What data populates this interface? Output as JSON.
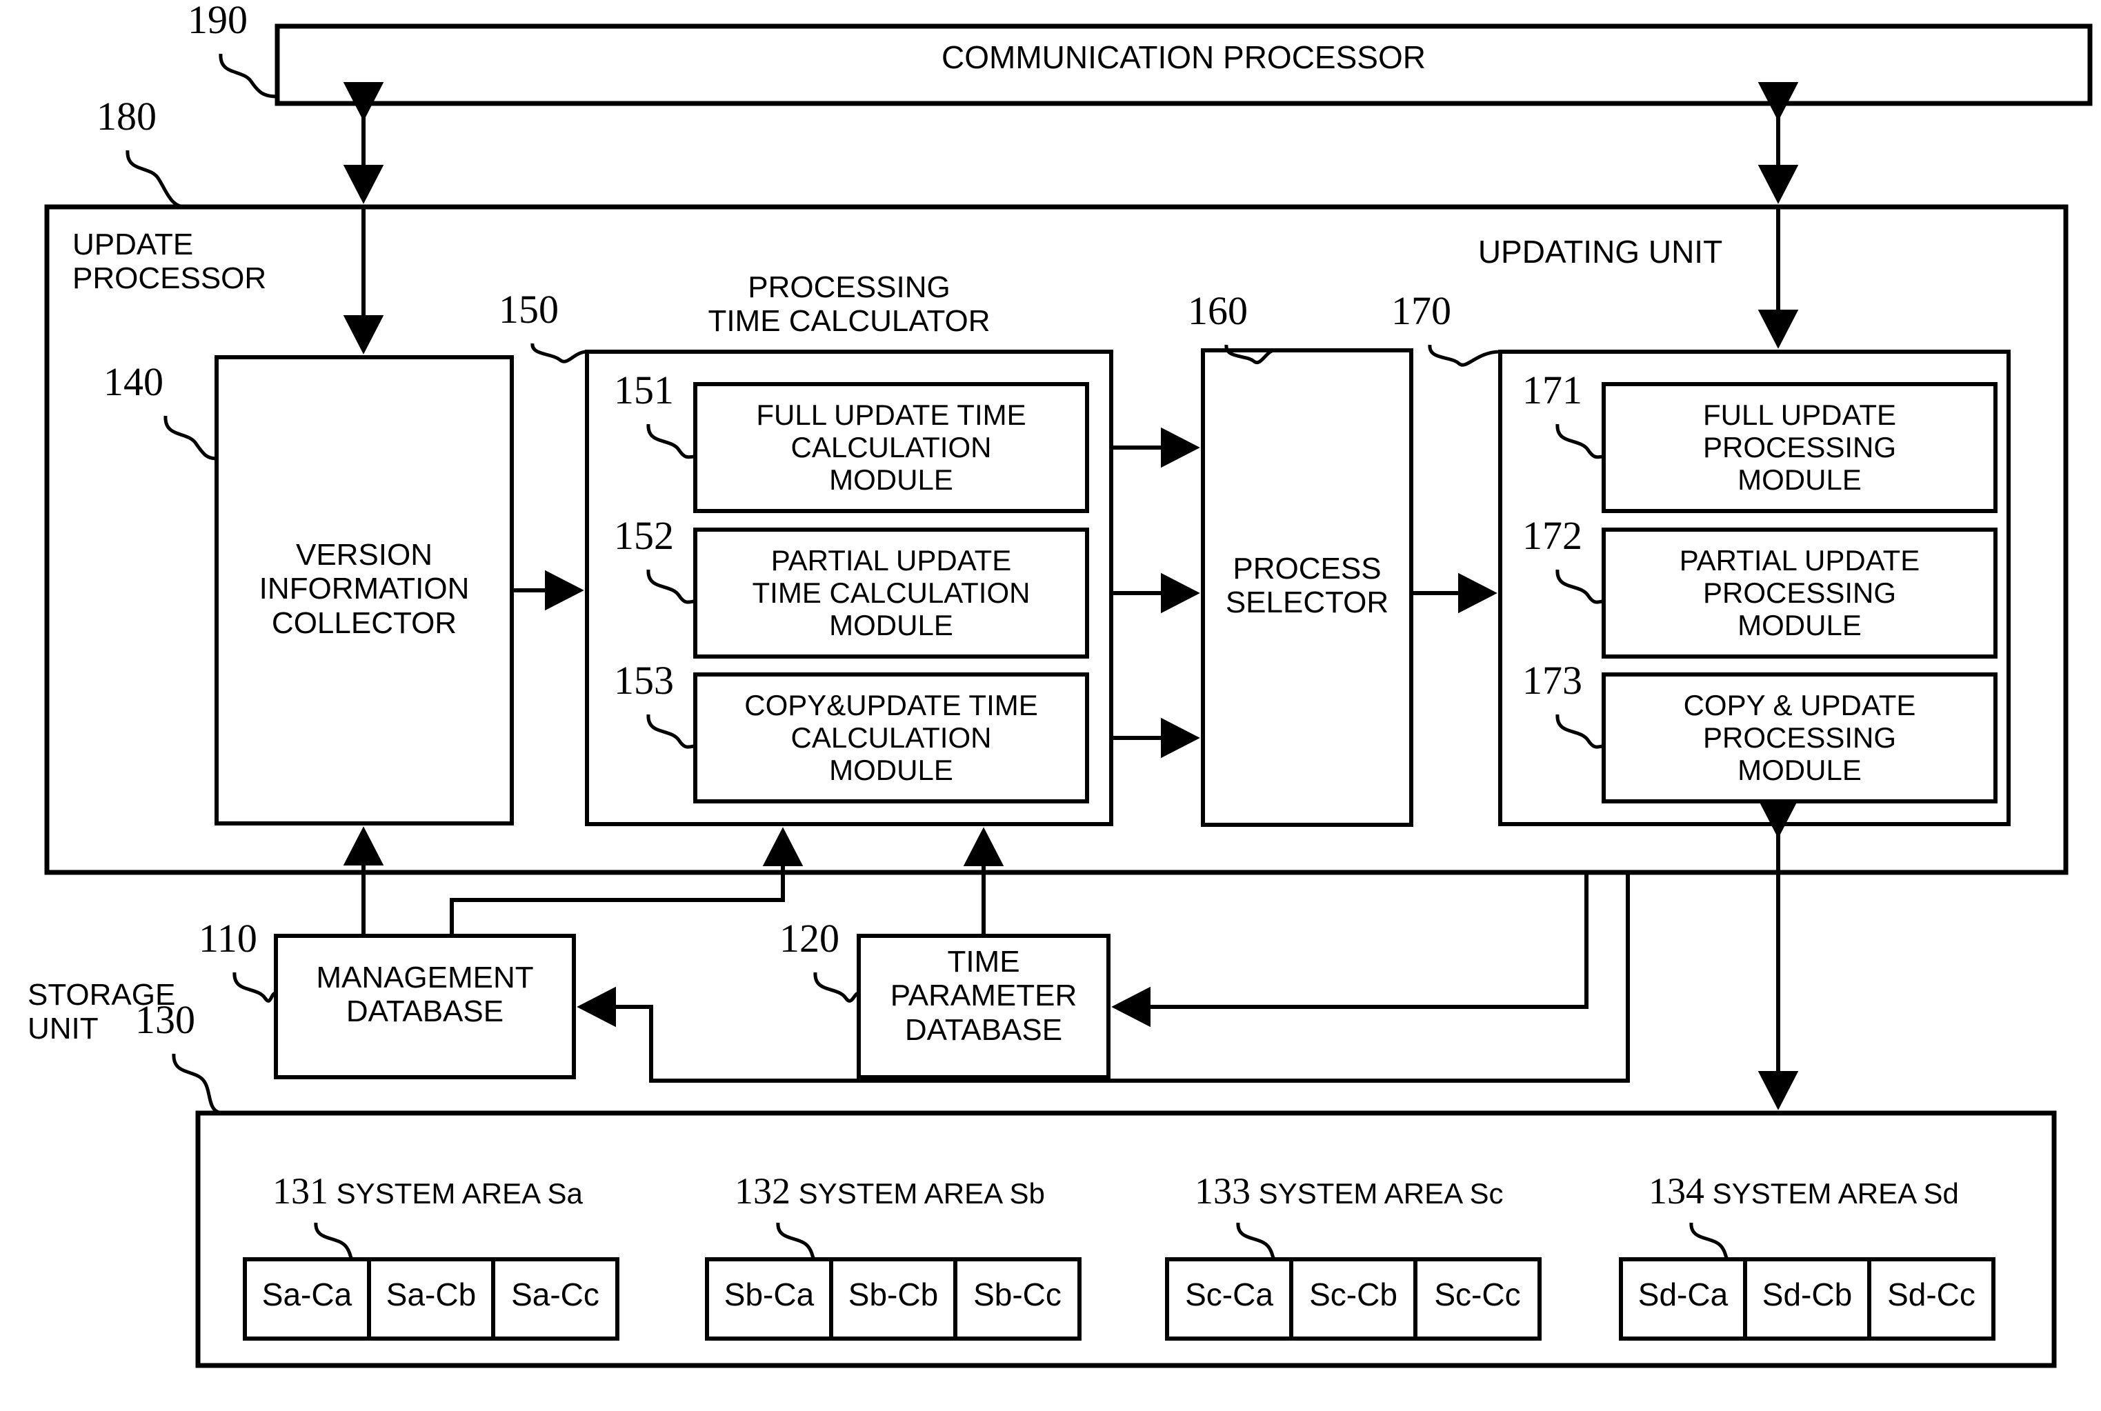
{
  "figure": {
    "type": "patent-block-diagram",
    "blocks": {
      "communication_processor": {
        "ref": "190",
        "label": "COMMUNICATION PROCESSOR"
      },
      "update_processor": {
        "ref": "180",
        "label": "UPDATE\nPROCESSOR"
      },
      "version_information_collector": {
        "ref": "140",
        "label": "VERSION\nINFORMATION\nCOLLECTOR"
      },
      "processing_time_calculator": {
        "ref": "150",
        "label": "PROCESSING\nTIME CALCULATOR",
        "modules": [
          {
            "ref": "151",
            "label": "FULL UPDATE TIME\nCALCULATION\nMODULE"
          },
          {
            "ref": "152",
            "label": "PARTIAL UPDATE\nTIME CALCULATION\nMODULE"
          },
          {
            "ref": "153",
            "label": "COPY&UPDATE TIME\nCALCULATION\nMODULE"
          }
        ]
      },
      "process_selector": {
        "ref": "160",
        "label": "PROCESS\nSELECTOR"
      },
      "updating_unit": {
        "ref": "170",
        "label": "UPDATING UNIT",
        "modules": [
          {
            "ref": "171",
            "label": "FULL UPDATE\nPROCESSING\nMODULE"
          },
          {
            "ref": "172",
            "label": "PARTIAL UPDATE\nPROCESSING\nMODULE"
          },
          {
            "ref": "173",
            "label": "COPY & UPDATE\nPROCESSING\nMODULE"
          }
        ]
      },
      "management_database": {
        "ref": "110",
        "label": "MANAGEMENT\nDATABASE"
      },
      "time_parameter_database": {
        "ref": "120",
        "label": "TIME\nPARAMETER\nDATABASE"
      },
      "storage_unit": {
        "ref": "130",
        "label": "STORAGE\nUNIT",
        "system_areas": [
          {
            "ref": "131",
            "label": "SYSTEM AREA Sa",
            "cells": [
              "Sa-Ca",
              "Sa-Cb",
              "Sa-Cc"
            ]
          },
          {
            "ref": "132",
            "label": "SYSTEM AREA Sb",
            "cells": [
              "Sb-Ca",
              "Sb-Cb",
              "Sb-Cc"
            ]
          },
          {
            "ref": "133",
            "label": "SYSTEM AREA Sc",
            "cells": [
              "Sc-Ca",
              "Sc-Cb",
              "Sc-Cc"
            ]
          },
          {
            "ref": "134",
            "label": "SYSTEM AREA Sd",
            "cells": [
              "Sd-Ca",
              "Sd-Cb",
              "Sd-Cc"
            ]
          }
        ]
      }
    },
    "colors": {
      "ink": "#000000",
      "paper": "#ffffff"
    }
  }
}
